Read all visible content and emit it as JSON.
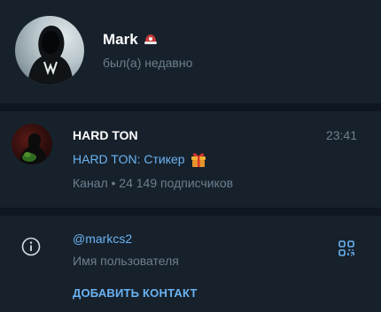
{
  "profile": {
    "name": "Mark",
    "status": "был(а) недавно",
    "emoji_status_icon": "cap-emoji-icon"
  },
  "channel": {
    "title": "HARD TON",
    "time": "23:41",
    "last_message": "HARD TON: Стикер",
    "last_message_icon": "gift-emoji-icon",
    "meta": "Канал • 24 149 подписчиков"
  },
  "info": {
    "username": "@markcs2",
    "username_label": "Имя пользователя",
    "add_contact_label": "ДОБАВИТЬ КОНТАКТ"
  },
  "colors": {
    "background": "#17212b",
    "divider": "#0e1621",
    "accent": "#6ab3f3",
    "secondary_text": "#6d7f8f",
    "primary_text": "#ffffff"
  }
}
